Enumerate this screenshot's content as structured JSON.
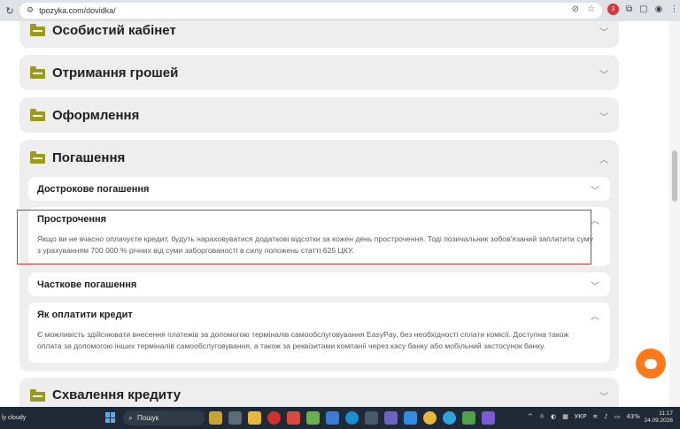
{
  "browser": {
    "url": "tpozyka.com/dovidka/",
    "ext_badge": "3"
  },
  "sections": [
    {
      "title": "Особистий кабінет",
      "icon": "folder-icon"
    },
    {
      "title": "Отримання грошей",
      "icon": "folder-icon"
    },
    {
      "title": "Оформлення",
      "icon": "folder-icon"
    },
    {
      "title": "Погашення",
      "icon": "folder-icon",
      "expanded": true,
      "items": [
        {
          "title": "Дострокове погашення"
        },
        {
          "title": "Прострочення",
          "text": "Якщо ви не вчасно оплачуєте кредит, будуть нараховуватися додаткові відсотки за кожен день прострочення. Тоді позичальник зобов'язаний заплатити суму з урахуванням 700 000 % річних від суми заборгованості в силу положень статті 625 ЦКУ."
        },
        {
          "title": "Часткове погашення"
        },
        {
          "title": "Як оплатити кредит",
          "text": "Є можливість здійснювати внесення платежів за допомогою терміналів самообслуговування EasyPay, без необхідності сплати комісії. Доступна також оплата за допомогою інших терміналів самообслуговування, а також за реквізитами компанії через касу банку або мобільний застосунок банку."
        }
      ]
    },
    {
      "title": "Схвалення кредиту",
      "icon": "folder-icon"
    }
  ],
  "taskbar": {
    "weather": "ly cloudy",
    "search_label": "Пошук",
    "language": "УКР",
    "battery": "43%",
    "time": "11:17",
    "date": "24.09.2026"
  },
  "colors": {
    "accent": "#9a9a1e",
    "highlight": "#e0302c",
    "chat": "#ff7a1a"
  }
}
